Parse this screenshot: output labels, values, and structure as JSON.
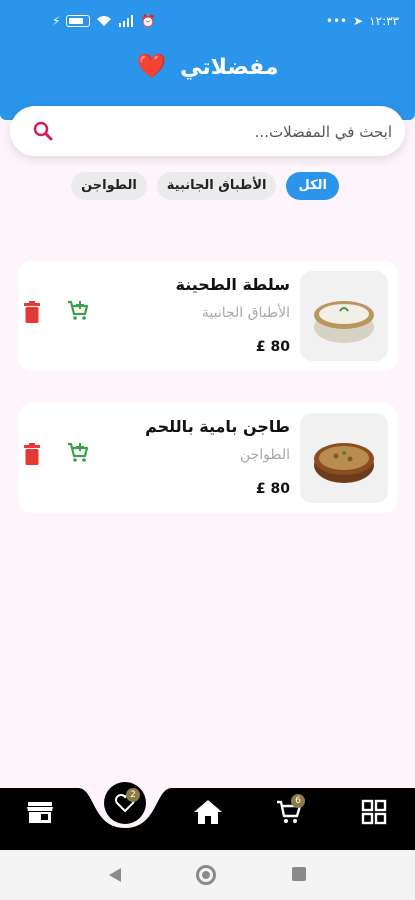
{
  "status_bar": {
    "time": "١٢:٣٣",
    "battery_icon": "battery-icon"
  },
  "header": {
    "title": "مفضلاتي",
    "emoji": "❤️"
  },
  "search": {
    "placeholder": "ابحث في المفضلات..."
  },
  "filters": [
    {
      "label": "الكل",
      "active": true
    },
    {
      "label": "الأطباق الجانبية",
      "active": false
    },
    {
      "label": "الطواجن",
      "active": false
    }
  ],
  "favorites": [
    {
      "name": "سلطة الطحينة",
      "category": "الأطباق الجانبية",
      "price": "80 £"
    },
    {
      "name": "طاجن بامية باللحم",
      "category": "الطواجن",
      "price": "80 £"
    }
  ],
  "bottom_nav": {
    "favorites_badge": "2",
    "cart_badge": "6"
  },
  "colors": {
    "accent": "#2a95ea",
    "delete": "#e53935",
    "add_cart": "#3aa14a",
    "badge": "#8c7a48"
  }
}
